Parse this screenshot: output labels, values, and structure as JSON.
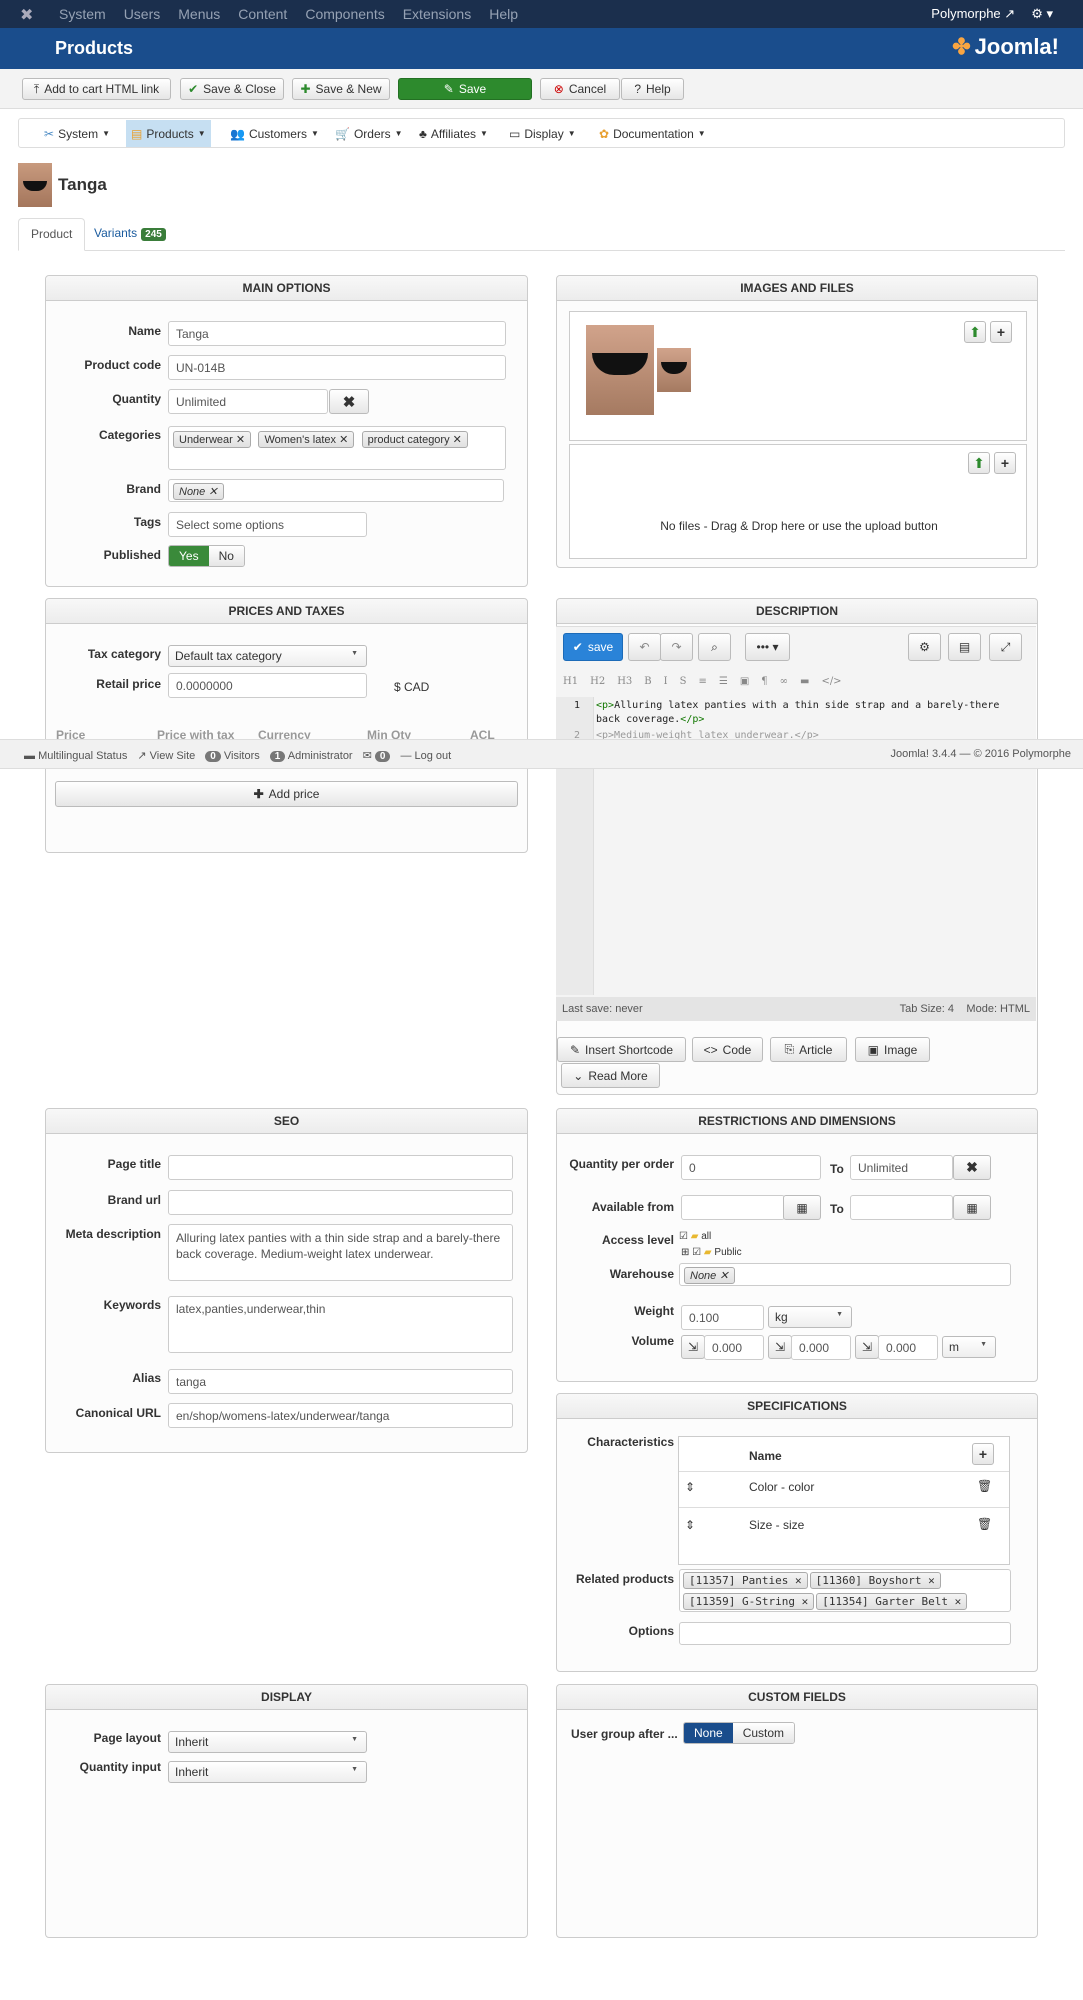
{
  "topbar": {
    "menu": [
      "System",
      "Users",
      "Menus",
      "Content",
      "Components",
      "Extensions",
      "Help"
    ],
    "site": "Polymorphe"
  },
  "header": {
    "title": "Products",
    "logo": "Joomla!"
  },
  "toolbar": {
    "add_cart": "Add to cart HTML link",
    "save_close": "Save & Close",
    "save_new": "Save & New",
    "save": "Save",
    "cancel": "Cancel",
    "help": "Help"
  },
  "nav": {
    "items": [
      "System",
      "Products",
      "Customers",
      "Orders",
      "Affiliates",
      "Display",
      "Documentation"
    ]
  },
  "product": {
    "title": "Tanga"
  },
  "tabs": {
    "product": "Product",
    "variants": "Variants",
    "variants_count": "245"
  },
  "main_options": {
    "title": "MAIN OPTIONS",
    "name_label": "Name",
    "name": "Tanga",
    "code_label": "Product code",
    "code": "UN-014B",
    "qty_label": "Quantity",
    "qty": "Unlimited",
    "cat_label": "Categories",
    "categories": [
      "Underwear",
      "Women's latex",
      "product category"
    ],
    "brand_label": "Brand",
    "brand": "None",
    "tags_label": "Tags",
    "tags_placeholder": "Select some options",
    "published_label": "Published",
    "yes": "Yes",
    "no": "No"
  },
  "images": {
    "title": "IMAGES AND FILES",
    "no_files": "No files - Drag & Drop here or use the upload button"
  },
  "prices": {
    "title": "PRICES AND TAXES",
    "tax_label": "Tax category",
    "tax": "Default tax category",
    "retail_label": "Retail price",
    "retail": "0.0000000",
    "currency": "$ CAD",
    "cols": [
      "Price",
      "Price with tax",
      "Currency",
      "Min Qty",
      "ACL"
    ],
    "add_price": "Add price"
  },
  "description": {
    "title": "DESCRIPTION",
    "save": "save",
    "line1a": "<p>",
    "line1b": "Alluring latex panties with a thin side strap and a barely-there",
    "line1c": "back coverage.",
    "line1d": "</p>",
    "line2": "<p>Medium-weight latex underwear.</p>",
    "last_save": "Last save: never",
    "tab_size": "Tab Size: 4",
    "mode": "Mode: HTML",
    "insert_shortcode": "Insert Shortcode",
    "code_btn": "Code",
    "article": "Article",
    "image": "Image",
    "read_more": "Read More"
  },
  "status": {
    "multilingual": "Multilingual Status",
    "view_site": "View Site",
    "visitors_count": "0",
    "visitors": "Visitors",
    "admin_count": "1",
    "admin": "Administrator",
    "msg_count": "0",
    "logout": "Log out",
    "version": "Joomla! 3.4.4 — © 2016 Polymorphe"
  },
  "seo": {
    "title": "SEO",
    "page_title_label": "Page title",
    "brand_url_label": "Brand url",
    "meta_label": "Meta description",
    "meta": "Alluring latex panties with a thin side strap and a barely-there back coverage. Medium-weight latex underwear.",
    "keywords_label": "Keywords",
    "keywords": "latex,panties,underwear,thin",
    "alias_label": "Alias",
    "alias": "tanga",
    "canonical_label": "Canonical URL",
    "canonical": "en/shop/womens-latex/underwear/tanga"
  },
  "restrictions": {
    "title": "RESTRICTIONS AND DIMENSIONS",
    "qpo_label": "Quantity per order",
    "qpo": "0",
    "to": "To",
    "qpo_to": "Unlimited",
    "avail_label": "Available from",
    "access_label": "Access level",
    "access_all": "all",
    "access_public": "Public",
    "warehouse_label": "Warehouse",
    "warehouse": "None",
    "weight_label": "Weight",
    "weight": "0.100",
    "weight_unit": "kg",
    "volume_label": "Volume",
    "vol1": "0.000",
    "vol2": "0.000",
    "vol3": "0.000",
    "vol_unit": "m"
  },
  "specifications": {
    "title": "SPECIFICATIONS",
    "char_label": "Characteristics",
    "name_col": "Name",
    "rows": [
      "Color - color",
      "Size - size"
    ],
    "related_label": "Related products",
    "related": [
      "[11357] Panties",
      "[11360] Boyshort",
      "[11359] G-String",
      "[11354] Garter Belt"
    ],
    "options_label": "Options"
  },
  "display": {
    "title": "DISPLAY",
    "layout_label": "Page layout",
    "layout": "Inherit",
    "qty_input_label": "Quantity input",
    "qty_input": "Inherit"
  },
  "custom_fields": {
    "title": "CUSTOM FIELDS",
    "ug_label": "User group after ...",
    "none": "None",
    "custom": "Custom"
  }
}
